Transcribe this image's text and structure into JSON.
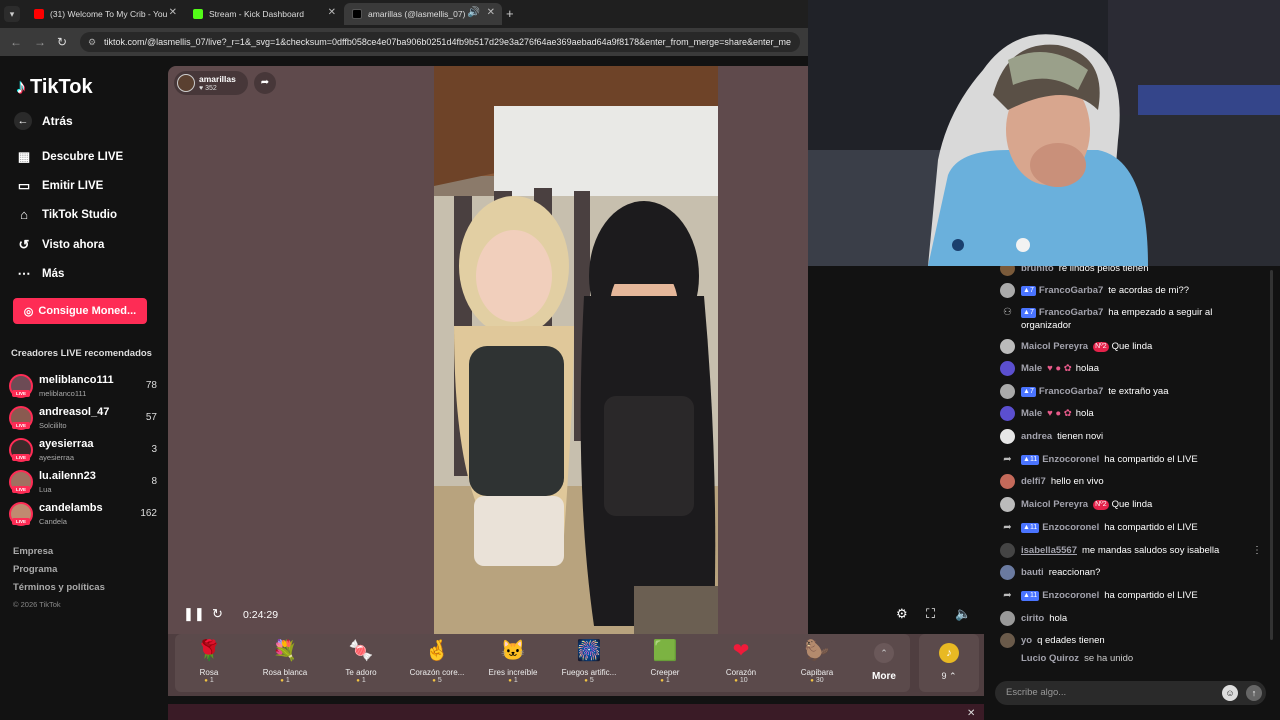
{
  "browser": {
    "tabs": [
      {
        "title": "(31) Welcome To My Crib - You",
        "color": "#ff0000"
      },
      {
        "title": "Stream - Kick Dashboard",
        "color": "#53fc18"
      },
      {
        "title": "amarillas (@lasmellis_07) e",
        "color": "#000000"
      }
    ],
    "url": "tiktok.com/@lasmellis_07/live?_r=1&_svg=1&checksum=0dffb058ce4e07ba906b0251d4fb9b517d29e3a276f64ae369aebad64a9f8178&enter_from_merge=share&enter_me"
  },
  "sidebar": {
    "brand": "TikTok",
    "back_label": "Atrás",
    "menu": [
      {
        "label": "Descubre LIVE",
        "icon": "calendar-icon"
      },
      {
        "label": "Emitir LIVE",
        "icon": "camera-icon"
      },
      {
        "label": "TikTok Studio",
        "icon": "home-icon"
      },
      {
        "label": "Visto ahora",
        "icon": "history-icon"
      },
      {
        "label": "Más",
        "icon": "more-icon"
      }
    ],
    "coins_button": "Consigue Moned...",
    "recommended_title": "Creadores LIVE recomendados",
    "creators": [
      {
        "name": "meliblanco111",
        "sub": "meliblanco111",
        "count": "78"
      },
      {
        "name": "andreasol_47",
        "sub": "Solcililto",
        "count": "57"
      },
      {
        "name": "ayesierraa",
        "sub": "ayesierraa",
        "count": "3"
      },
      {
        "name": "lu.ailenn23",
        "sub": "Lua",
        "count": "8"
      },
      {
        "name": "candelambs",
        "sub": "Candela",
        "count": "162"
      }
    ],
    "footer": [
      "Empresa",
      "Programa",
      "Términos y políticas"
    ],
    "copyright": "© 2026 TikTok"
  },
  "player": {
    "host_name": "amarillas",
    "host_likes": "352",
    "elapsed": "0:24:29"
  },
  "gifts": [
    {
      "name": "Rosa",
      "price": "1",
      "glyph": "🌹"
    },
    {
      "name": "Rosa blanca",
      "price": "1",
      "glyph": "💐"
    },
    {
      "name": "Te adoro",
      "price": "1",
      "glyph": "🍬"
    },
    {
      "name": "Corazón core...",
      "price": "5",
      "glyph": "🤞"
    },
    {
      "name": "Eres increíble",
      "price": "1",
      "glyph": "🐱"
    },
    {
      "name": "Fuegos artific...",
      "price": "5",
      "glyph": "🎆"
    },
    {
      "name": "Creeper",
      "price": "1",
      "glyph": "🟩"
    },
    {
      "name": "Corazón",
      "price": "10",
      "glyph": "❤"
    },
    {
      "name": "Capibara",
      "price": "30",
      "glyph": "🦫"
    }
  ],
  "gift_more": "More",
  "coin_balance": "9",
  "chat": {
    "messages": [
      {
        "user": "brunito",
        "text": "re lindos pelos tienen"
      },
      {
        "user": "FrancoGarba7",
        "level": "7",
        "text": "te acordas de mi??"
      },
      {
        "user": "FrancoGarba7",
        "level": "7",
        "text": "ha empezado a seguir al organizador",
        "type": "follow"
      },
      {
        "user": "Maicol Pereyra",
        "rank": "Nº2",
        "text": "Que linda"
      },
      {
        "user": "Male",
        "text": "holaa"
      },
      {
        "user": "FrancoGarba7",
        "level": "7",
        "text": "te extraño yaa"
      },
      {
        "user": "Male",
        "text": "hola"
      },
      {
        "user": "andrea",
        "text": "tienen novi"
      },
      {
        "user": "Enzocoronel",
        "level": "11",
        "text": "ha compartido el LIVE",
        "type": "share"
      },
      {
        "user": "delfi7",
        "text": "hello en vivo"
      },
      {
        "user": "Maicol Pereyra",
        "rank": "Nº2",
        "text": "Que linda"
      },
      {
        "user": "Enzocoronel",
        "level": "11",
        "text": "ha compartido el LIVE",
        "type": "share"
      },
      {
        "user": "isabella5567",
        "text": "me mandas saludos soy isabella"
      },
      {
        "user": "bauti",
        "text": "reaccionan?"
      },
      {
        "user": "Enzocoronel",
        "level": "11",
        "text": "ha compartido el LIVE",
        "type": "share"
      },
      {
        "user": "cirito",
        "text": "hola"
      },
      {
        "user": "yo",
        "text": "q edades tienen"
      },
      {
        "user": "Lucio Quiroz",
        "text": "se ha unido",
        "type": "join"
      }
    ],
    "input_placeholder": "Escribe algo..."
  }
}
